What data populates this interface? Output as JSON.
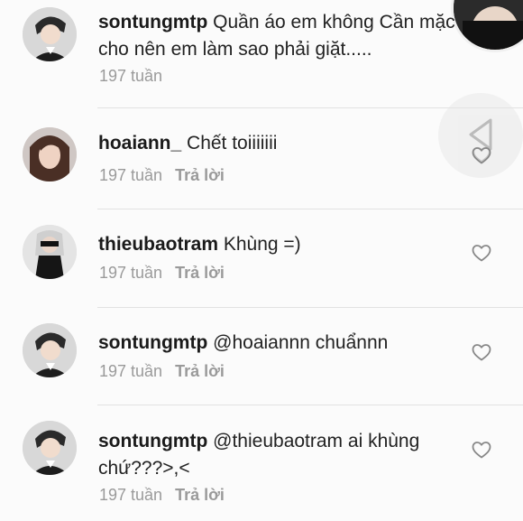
{
  "comments": [
    {
      "username": "sontungmtp",
      "text": "Quần áo em không Cần mặc cho nên em làm sao phải giặt.....",
      "time": "197 tuần",
      "reply": ""
    },
    {
      "username": "hoaiann_",
      "text": "Chết toiiiiiii",
      "time": "197 tuần",
      "reply": "Trả lời"
    },
    {
      "username": "thieubaotram",
      "text": "Khùng =)",
      "time": "197 tuần",
      "reply": "Trả lời"
    },
    {
      "username": "sontungmtp",
      "text": "@hoaiannn chuẩnnn",
      "time": "197 tuần",
      "reply": "Trả lời"
    },
    {
      "username": "sontungmtp",
      "text": "@thieubaotram  ai khùng chứ???>,<",
      "time": "197 tuần",
      "reply": "Trả lời"
    }
  ],
  "icons": {
    "heart": "heart-outline-icon",
    "share": "share-arrow-icon"
  },
  "colors": {
    "text": "#222222",
    "meta": "#9a9a9a",
    "divider": "#e2e2e2",
    "background": "#fbfbfb"
  }
}
